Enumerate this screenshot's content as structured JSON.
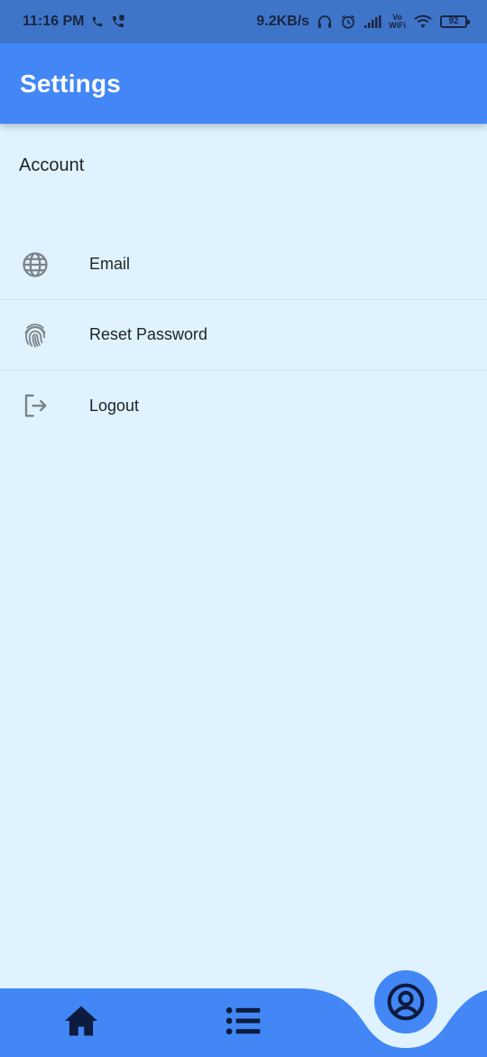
{
  "status_bar": {
    "time": "11:16 PM",
    "network_speed": "9.2KB/s",
    "volte_top": "Vo",
    "volte_bottom": "WiFi",
    "battery": "92",
    "icons": [
      "phone-icon",
      "call-forward-icon",
      "headphones-icon",
      "alarm-icon",
      "signal-icon",
      "wifi-icon",
      "battery-icon"
    ]
  },
  "appbar": {
    "title": "Settings"
  },
  "section": {
    "title": "Account"
  },
  "settings_items": [
    {
      "label": "Email",
      "icon": "globe-icon"
    },
    {
      "label": "Reset Password",
      "icon": "fingerprint-icon"
    },
    {
      "label": "Logout",
      "icon": "logout-icon"
    }
  ],
  "bottom_nav": {
    "items": [
      "home-icon",
      "list-icon",
      "account-circle-icon"
    ],
    "active": "account-circle-icon"
  },
  "colors": {
    "status_bar": "#3f75c9",
    "primary": "#4287f5",
    "background": "#dff2fd",
    "icon_gray": "#7b8288",
    "nav_icon": "#0d1b3e"
  }
}
